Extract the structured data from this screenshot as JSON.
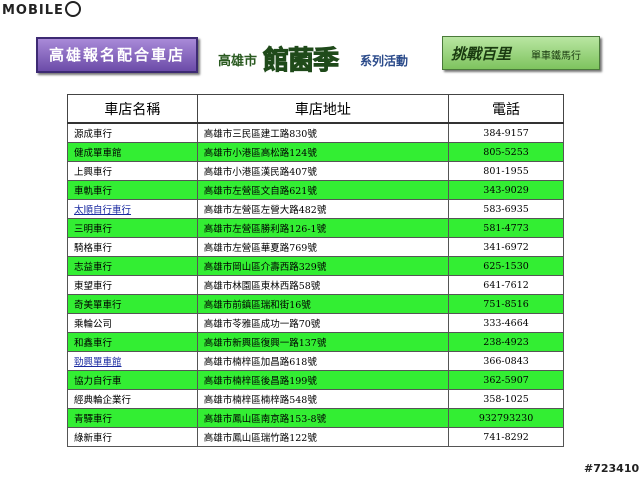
{
  "watermark": "MOBILE",
  "header": {
    "left_title": "高雄報名配合車店",
    "mid_city": "高雄市",
    "mid_brand": "館菌季",
    "mid_activity": "系列活動",
    "right_main": "挑戰百里",
    "right_sub": "單車鐵馬行"
  },
  "table": {
    "columns": [
      "車店名稱",
      "車店地址",
      "電話"
    ],
    "rows": [
      {
        "name": "源成車行",
        "address": "高雄市三民區建工路830號",
        "phone": "384-9157",
        "link": false
      },
      {
        "name": "健成單車館",
        "address": "高雄市小港區高松路124號",
        "phone": "805-5253",
        "link": false
      },
      {
        "name": "上興車行",
        "address": "高雄市小港區漢民路407號",
        "phone": "801-1955",
        "link": false
      },
      {
        "name": "車軌車行",
        "address": "高雄市左營區文自路621號",
        "phone": "343-9029",
        "link": false
      },
      {
        "name": "太順自行車行",
        "address": "高雄市左營區左營大路482號",
        "phone": "583-6935",
        "link": true
      },
      {
        "name": "三明車行",
        "address": "高雄市左營區勝利路126-1號",
        "phone": "581-4773",
        "link": false
      },
      {
        "name": "騎格車行",
        "address": "高雄市左營區華夏路769號",
        "phone": "341-6972",
        "link": false
      },
      {
        "name": "志益車行",
        "address": "高雄市岡山區介壽西路329號",
        "phone": "625-1530",
        "link": false
      },
      {
        "name": "東望車行",
        "address": "高雄市林園區東林西路58號",
        "phone": "641-7612",
        "link": false
      },
      {
        "name": "奇美單車行",
        "address": "高雄市前鎮區瑞和街16號",
        "phone": "751-8516",
        "link": false
      },
      {
        "name": "乘輪公司",
        "address": "高雄市苓雅區成功一路70號",
        "phone": "333-4664",
        "link": false
      },
      {
        "name": "和鑫車行",
        "address": "高雄市新興區復興一路137號",
        "phone": "238-4923",
        "link": false
      },
      {
        "name": "勁興單車館",
        "address": "高雄市楠梓區加昌路618號",
        "phone": "366-0843",
        "link": true
      },
      {
        "name": "協力自行車",
        "address": "高雄市楠梓區後昌路199號",
        "phone": "362-5907",
        "link": false
      },
      {
        "name": "經典輪企業行",
        "address": "高雄市楠梓區楠梓路548號",
        "phone": "358-1025",
        "link": false
      },
      {
        "name": "青驛車行",
        "address": "高雄市鳳山區南京路153-8號",
        "phone": "932793230",
        "link": false
      },
      {
        "name": "綠新車行",
        "address": "高雄市鳳山區瑞竹路122號",
        "phone": "741-8292",
        "link": false
      }
    ]
  },
  "stamp": "#723410",
  "colors": {
    "row_green": "#33ee33",
    "row_white": "#ffffff",
    "link": "#1a2aa0"
  }
}
